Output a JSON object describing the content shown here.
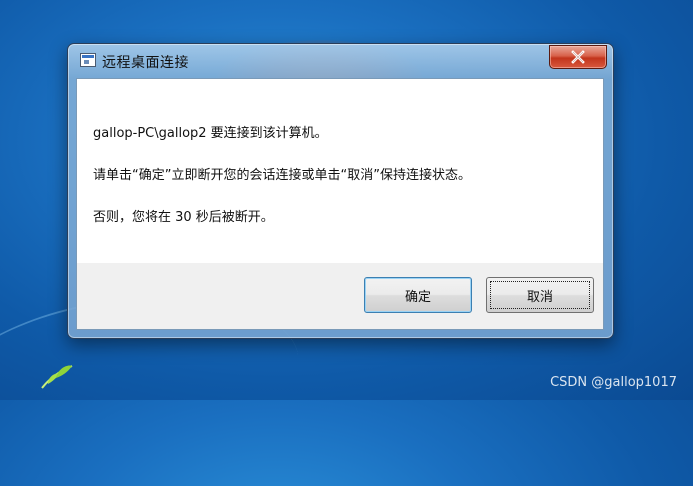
{
  "window": {
    "title": "远程桌面连接",
    "close_icon": "close-icon"
  },
  "message": {
    "line1": "gallop-PC\\gallop2 要连接到该计算机。",
    "line2": "请单击“确定”立即断开您的会话连接或单击“取消”保持连接状态。",
    "line3": "否则，您将在 30 秒后被断开。"
  },
  "buttons": {
    "ok_label": "确定",
    "cancel_label": "取消"
  },
  "watermark": "CSDN @gallop1017",
  "colors": {
    "desktop_blue": "#1a6fc0",
    "close_red": "#c2351c",
    "default_button_border": "#3c7fb1"
  }
}
